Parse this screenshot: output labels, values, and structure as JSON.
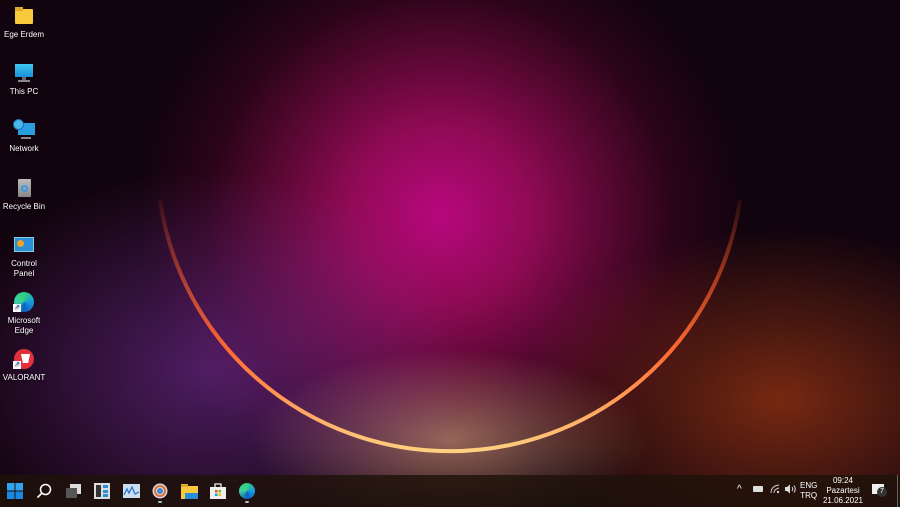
{
  "desktop_icons": [
    {
      "label": "Ege Erdem",
      "icon": "folder-icon"
    },
    {
      "label": "This PC",
      "icon": "monitor-icon"
    },
    {
      "label": "Network",
      "icon": "network-icon"
    },
    {
      "label": "Recycle Bin",
      "icon": "recycle-bin-icon"
    },
    {
      "label": "Control Panel",
      "icon": "control-panel-icon"
    },
    {
      "label": "Microsoft Edge",
      "icon": "edge-icon"
    },
    {
      "label": "VALORANT",
      "icon": "valorant-icon"
    }
  ],
  "taskbar": {
    "apps": [
      "start",
      "search",
      "task-view",
      "widgets",
      "photos",
      "chrome-canary",
      "file-explorer",
      "store",
      "edge"
    ],
    "tray": {
      "lang_top": "ENG",
      "lang_bottom": "TRQ",
      "time": "09:24",
      "day": "Pazartesi",
      "date": "21.06.2021",
      "notification_count": "7"
    }
  },
  "colors": {
    "accent": "#1e90ff"
  }
}
